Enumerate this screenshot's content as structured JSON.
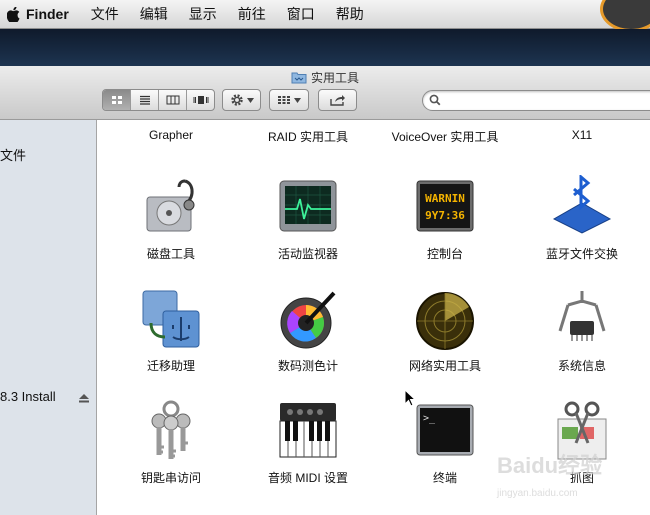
{
  "menubar": {
    "app_name": "Finder",
    "items": [
      "文件",
      "编辑",
      "显示",
      "前往",
      "窗口",
      "帮助"
    ]
  },
  "window": {
    "title": "实用工具",
    "search": {
      "value": "",
      "placeholder": ""
    }
  },
  "sidebar": {
    "items": [
      {
        "label": "文件"
      },
      {
        "label": "8.3 Install"
      }
    ]
  },
  "content": {
    "top_row": [
      "Grapher",
      "RAID 实用工具",
      "VoiceOver 实用工具",
      "X11"
    ],
    "apps": [
      {
        "label": "磁盘工具",
        "icon": "disk-utility-icon"
      },
      {
        "label": "活动监视器",
        "icon": "activity-monitor-icon"
      },
      {
        "label": "控制台",
        "icon": "console-icon"
      },
      {
        "label": "蓝牙文件交换",
        "icon": "bluetooth-icon"
      },
      {
        "label": "迁移助理",
        "icon": "migration-assistant-icon"
      },
      {
        "label": "数码测色计",
        "icon": "color-meter-icon"
      },
      {
        "label": "网络实用工具",
        "icon": "network-utility-icon"
      },
      {
        "label": "系统信息",
        "icon": "system-information-icon"
      },
      {
        "label": "钥匙串访问",
        "icon": "keychain-icon"
      },
      {
        "label": "音频 MIDI 设置",
        "icon": "audio-midi-icon"
      },
      {
        "label": "终端",
        "icon": "terminal-icon"
      },
      {
        "label": "抓图",
        "icon": "grab-icon"
      }
    ],
    "console_text": [
      "WARNIN",
      "9Y7:36"
    ],
    "terminal_prompt": ">_"
  },
  "watermark": {
    "text": "Baidu经验",
    "url_text": "jingyan.baidu.com"
  },
  "colors": {
    "menubar": "#e3e3e3",
    "sidebar": "#dde3ea",
    "desktop": "#1b2a3e"
  }
}
